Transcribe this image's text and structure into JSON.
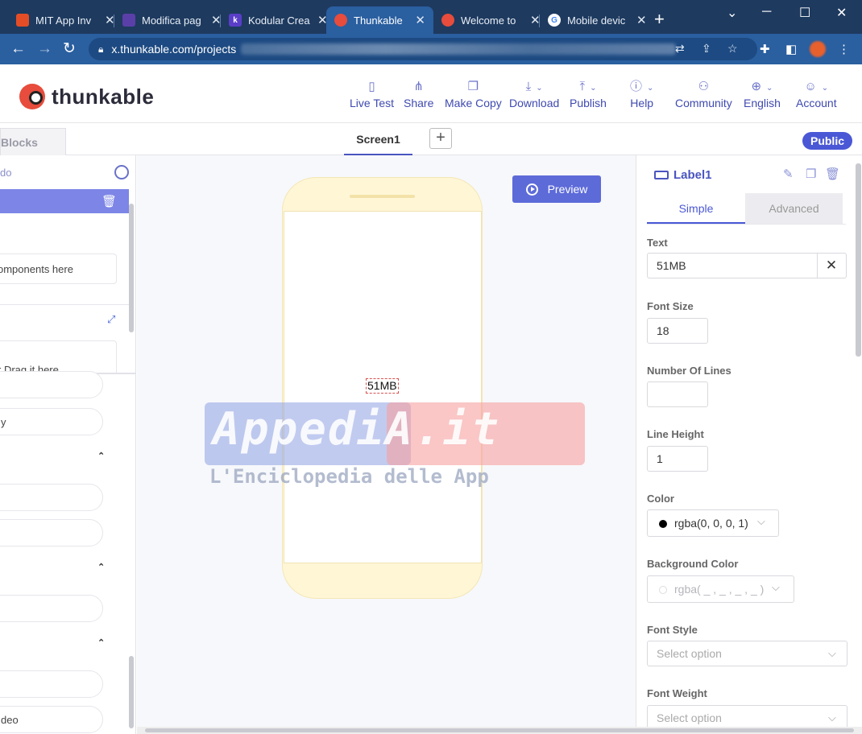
{
  "browser": {
    "tabs": [
      {
        "title": "MIT App Inv",
        "favicon": "mit-app-inventor",
        "color": "#e44d26"
      },
      {
        "title": "Modifica pag",
        "favicon": "wordpress-edit",
        "color": "#5b3fa8"
      },
      {
        "title": "Kodular Crea",
        "favicon": "kodular",
        "color": "#5a3ec8"
      },
      {
        "title": "Thunkable",
        "favicon": "thunkable",
        "color": "#e74c3c"
      },
      {
        "title": "Welcome to",
        "favicon": "thunkable",
        "color": "#e74c3c"
      },
      {
        "title": "Mobile devic",
        "favicon": "google",
        "color": "#4285f4"
      }
    ],
    "address": "x.thunkable.com/projects"
  },
  "header": {
    "logo_text": "thunkable",
    "nav": [
      {
        "label": "Live Test",
        "icon": "phone-icon"
      },
      {
        "label": "Share",
        "icon": "share-icon"
      },
      {
        "label": "Make Copy",
        "icon": "copy-icon"
      },
      {
        "label": "Download",
        "icon": "download-icon"
      },
      {
        "label": "Publish",
        "icon": "upload-icon"
      },
      {
        "label": "Help",
        "icon": "info-icon"
      },
      {
        "label": "Community",
        "icon": "community-icon"
      },
      {
        "label": "English",
        "icon": "globe-icon"
      },
      {
        "label": "Account",
        "icon": "user-icon"
      }
    ]
  },
  "subheader": {
    "blocks_tab": "Blocks",
    "screen_tab": "Screen1",
    "add_screen": "+",
    "public_badge": "Public"
  },
  "left_panel": {
    "partial_top": "do",
    "drop_hint": "omponents here",
    "drag_hint": "r Drag it here",
    "pill_partial_1": "y",
    "pill_partial_2": "deo"
  },
  "canvas": {
    "preview_label": "Preview",
    "label_text": "51MB"
  },
  "watermark": {
    "title": "AppediA.it",
    "subtitle": "L'Enciclopedia delle App"
  },
  "properties": {
    "component_name": "Label1",
    "tabs": {
      "simple": "Simple",
      "advanced": "Advanced"
    },
    "text_label": "Text",
    "text_value": "51MB",
    "font_size_label": "Font Size",
    "font_size_value": "18",
    "lines_label": "Number Of Lines",
    "lines_value": "",
    "line_height_label": "Line Height",
    "line_height_value": "1",
    "color_label": "Color",
    "color_value": "rgba(0, 0, 0, 1)",
    "bg_color_label": "Background Color",
    "bg_color_value": "rgba( _ , _ , _ , _ )",
    "font_style_label": "Font Style",
    "font_style_placeholder": "Select option",
    "font_weight_label": "Font Weight",
    "font_weight_placeholder": "Select option"
  }
}
